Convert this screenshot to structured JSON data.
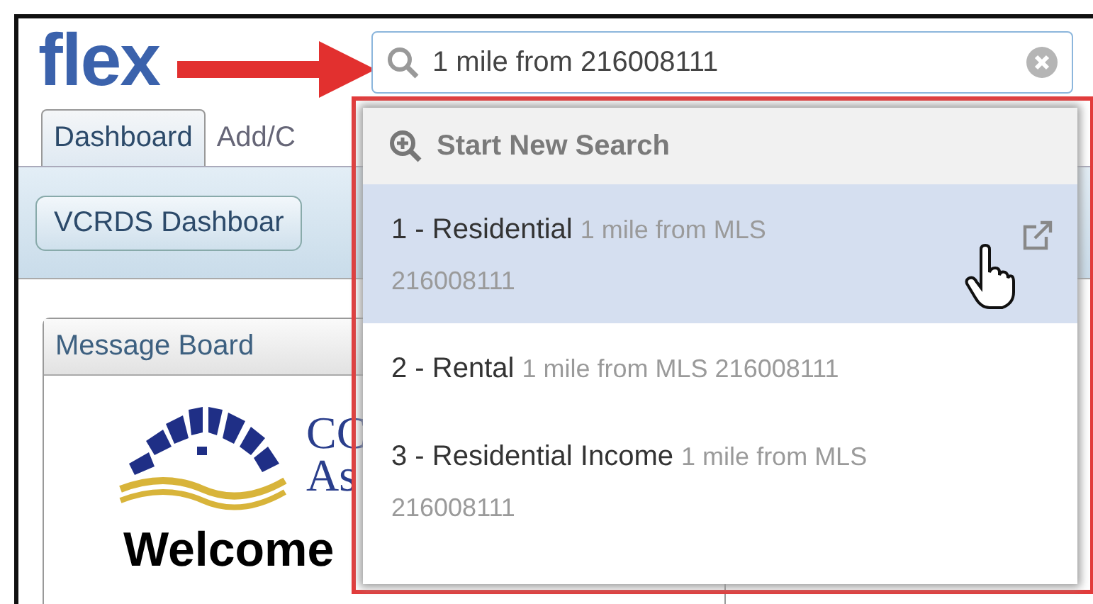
{
  "logo": {
    "text": "flex"
  },
  "search": {
    "value": "1 mile from 216008111"
  },
  "tabs": [
    {
      "label": "Dashboard",
      "selected": true
    },
    {
      "label": "Add/C",
      "selected": false
    }
  ],
  "toolbar": {
    "button": "VCRDS Dashboar"
  },
  "message_board": {
    "title": "Message Board",
    "org_name_lines": [
      "CC",
      "As"
    ],
    "welcome": "Welcome"
  },
  "dropdown": {
    "header": "Start New Search",
    "items": [
      {
        "title": "1 - Residential",
        "detail": "1 mile from MLS 216008111",
        "selected": true
      },
      {
        "title": "2 - Rental",
        "detail": "1 mile from MLS 216008111",
        "selected": false
      },
      {
        "title": "3 - Residential Income",
        "detail": "1 mile from MLS 216008111",
        "selected": false
      }
    ]
  }
}
